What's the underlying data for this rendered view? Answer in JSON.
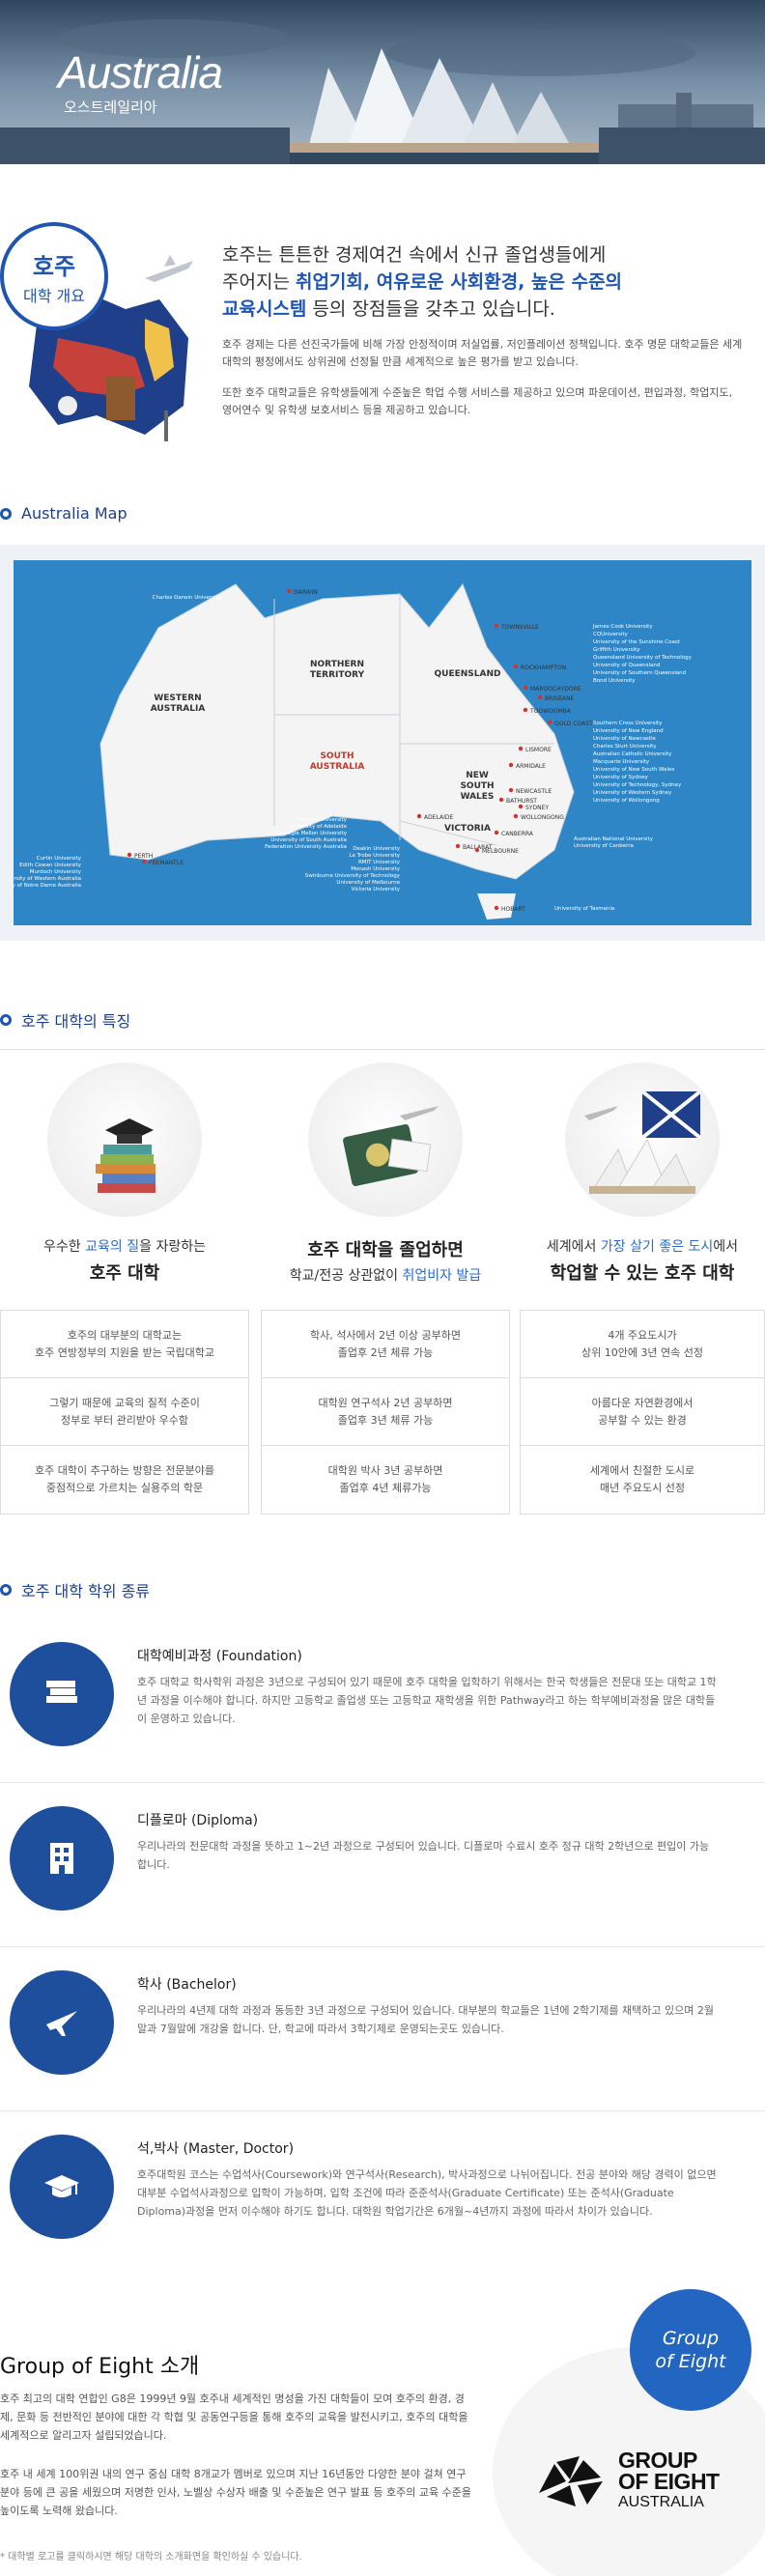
{
  "hero": {
    "title": "Australia",
    "subtitle": "오스트레일리아"
  },
  "intro": {
    "badge_line1": "호주",
    "badge_line2": "대학 개요",
    "lead_1": "호주는 튼튼한 경제여건 속에서 신규 졸업생들에게",
    "lead_2a": "주어지는 ",
    "lead_2b": "취업기회, 여유로운 사회환경, 높은 수준의",
    "lead_3a": "교육시스템",
    "lead_3b": " 등의 장점들을 갖추고 있습니다.",
    "para_1": "호주 경제는 다른 선진국가들에 비해 가장 안정적이며 저실업률, 저인플레이션 정책입니다. 호주 명문 대학교들은 세계대학의 평정에서도 상위권에 선정될 만큼 세계적으로 높은 평가를 받고 있습니다.",
    "para_2": "또한 호주 대학교들은 유학생들에게 수준높은 학업 수행 서비스를 제공하고 있으며 파운데이션, 편입과정, 학업지도, 영어연수 및 유학생 보호서비스 등을 제공하고 있습니다."
  },
  "map_section": {
    "title": "Australia Map",
    "regions": [
      "WESTERN AUSTRALIA",
      "NORTHERN TERRITORY",
      "SOUTH AUSTRALIA",
      "QUEENSLAND",
      "NEW SOUTH WALES",
      "VICTORIA"
    ],
    "cities": [
      "DARWIN",
      "PERTH",
      "FREMANTLE",
      "ADELAIDE",
      "TOWNSVILLE",
      "ROCKHAMPTON",
      "MAROOCHYDORE",
      "BRISBANE",
      "TOOWOOMBA",
      "GOLD COAST",
      "LISMORE",
      "ARMIDALE",
      "NEWCASTLE",
      "BATHURST",
      "SYDNEY",
      "WOLLONGONG",
      "CANBERRA",
      "BALLARAT",
      "MELBOURNE",
      "HOBART"
    ],
    "universities_north": [
      "Charles Darwin University"
    ],
    "universities_west": [
      "Curtin University",
      "Edith Cowan University",
      "Murdoch University",
      "University of Western Australia",
      "University of Notre Dame Australia"
    ],
    "universities_south": [
      "Flinders University",
      "University of Adelaide",
      "Carnegie Mellon University",
      "University of South Australia",
      "Federation University Australia"
    ],
    "universities_vic": [
      "Deakin University",
      "La Trobe University",
      "RMIT University",
      "Monash University",
      "Swinburne University of Technology",
      "University of Melbourne",
      "Victoria University"
    ],
    "universities_qld": [
      "James Cook University",
      "CQUniversity",
      "University of the Sunshine Coast",
      "Griffith University",
      "Queensland University of Technology",
      "University of Queensland",
      "University of Southern Queensland",
      "Bond University"
    ],
    "universities_nsw": [
      "Southern Cross University",
      "University of New England",
      "University of Newcastle",
      "Charles Sturt University",
      "Australian Catholic University",
      "Macquarie University",
      "University of New South Wales",
      "University of Sydney",
      "University of Technology, Sydney",
      "University of Western Sydney",
      "University of Wollongong"
    ],
    "universities_act": [
      "Australian National University",
      "University of Canberra"
    ],
    "universities_tas": [
      "University of Tasmania"
    ]
  },
  "features_section": {
    "title": "호주 대학의 특징",
    "cards": [
      {
        "cap1a": "우수한 ",
        "cap1b": "교육의 질",
        "cap1c": "을 자랑하는",
        "cap2": "호주 대학",
        "rows": [
          "호주의 대부분의 대학교는\n호주 연방정부의 지원을 받는 국립대학교",
          "그렇기 때문에 교육의 질적 수준이\n정부로 부터 관리받아 우수함",
          "호주 대학이 추구하는 방향은 전문분야를\n중점적으로 가르치는 실용주의 학문"
        ]
      },
      {
        "cap1a": "",
        "cap1b": "",
        "cap1c": "",
        "cap2": "호주 대학을 졸업하면",
        "cap3a": "학교/전공 상관없이 ",
        "cap3b": "취업비자 발급",
        "rows": [
          "학사, 석사에서 2년 이상 공부하면\n졸업후 2년 체류 가능",
          "대학원 연구석사 2년 공부하면\n졸업후 3년 체류 가능",
          "대학원 박사 3년 공부하면\n졸업후 4년 체류가능"
        ]
      },
      {
        "cap1a": "세계에서 ",
        "cap1b": "가장 살기 좋은 도시",
        "cap1c": "에서",
        "cap2": "학업할 수 있는 호주 대학",
        "rows": [
          "4개 주요도시가\n상위 10안에 3년 연속 선정",
          "아름다운 자연환경에서\n공부할 수 있는 환경",
          "세계에서 친절한 도시로\n매년 주요도시 선정"
        ]
      }
    ]
  },
  "degrees_section": {
    "title": "호주 대학 학위 종류",
    "items": [
      {
        "icon": "books-icon",
        "title": "대학예비과정 (Foundation)",
        "desc": "호주 대학교 학사학위 과정은 3년으로 구성되어 있기 때문에 호주 대학을 입학하기 위해서는 한국 학생들은 전문대 또는 대학교 1학년 과정을 이수해야 합니다. 하지만 고등학교 졸업생 또는 고등학교 재학생을 위한 Pathway라고 하는 학부예비과정을 많은 대학들이 운영하고 있습니다."
      },
      {
        "icon": "building-icon",
        "title": "디플로마 (Diploma)",
        "desc": "우리나라의 전문대학 과정을 뜻하고 1~2년 과정으로 구성되어 있습니다. 디플로마 수료시 호주 정규 대학 2학년으로 편입이 가능합니다."
      },
      {
        "icon": "airplane-icon",
        "title": "학사 (Bachelor)",
        "desc": "우리나라의 4년제 대학 과정과 동등한 3년 과정으로 구성되어 있습니다. 대부분의 학교들은 1년에 2학기제를 채택하고 있으며 2월말과 7월말에 개강을 합니다. 단, 학교에 따라서 3학기제로 운영되는곳도 있습니다."
      },
      {
        "icon": "graduation-cap-icon",
        "title": "석,박사 (Master, Doctor)",
        "desc": "호주대학원 코스는 수업석사(Coursework)와 연구석사(Research), 박사과정으로 나뉘어집니다. 전공 분야와 해당 경력이 없으면 대부분 수업석사과정으로 입학이 가능하며, 입학 조건에 따라 준준석사(Graduate Certificate) 또는 준석사(Graduate Diploma)과정을 먼저 이수해야 하기도 합니다. 대학원 학업기간은 6개월~4년까지 과정에 따라서 차이가 있습니다."
      }
    ]
  },
  "go8": {
    "title": "Group of Eight 소개",
    "badge_line1": "Group",
    "badge_line2": "of Eight",
    "logo_line1": "GROUP",
    "logo_line2": "OF EIGHT",
    "logo_line3": "AUSTRALIA",
    "para_1": "호주 최고의 대학 연합인 G8은 1999년 9월 호주내 세계적인 명성을 가진 대학들이 모여 호주의 환경, 경제, 문화 등 전반적인 분야에 대한 각 학협 및 공동연구등을 통해 호주의 교육을 발전시키고, 호주의 대학을 세계적으로 알리고자 설립되었습니다.",
    "para_2": "호주 내 세계 100위권 내의 연구 중심 대학 8개교가 멤버로 있으며 지난 16년동안 다양한 분야 걸쳐 연구분야 등에 큰 공을 세웠으며 저명한 인사, 노벨상 수상자 배출 및 수준높은 연구 발표 등 호주의 교육 수준을 높이도록 노력해 왔습니다.",
    "note": "* 대학별 로고를 클릭하시면 해당 대학의 소개화면을 확인하실 수 있습니다."
  },
  "colors": {
    "accent": "#1d55b0",
    "highlight": "#2a6cc8",
    "map_sea": "#2f86c6",
    "map_land": "#f4f4f4",
    "region_text": "#c0392b",
    "icon_bg": "#1e4f9c"
  }
}
